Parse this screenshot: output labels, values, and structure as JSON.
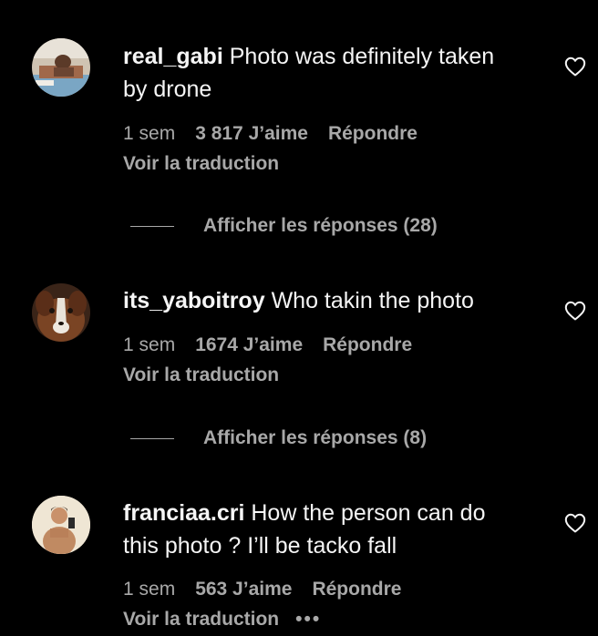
{
  "theme": {
    "background": "#000000",
    "primary_text": "#f5f5f5",
    "secondary_text": "#a8a8a8"
  },
  "comments": [
    {
      "username": "real_gabi",
      "text": "Photo was definitely taken by drone",
      "age": "1 sem",
      "likes": "3 817 J’aime",
      "reply_label": "Répondre",
      "translate_label": "Voir la traduction",
      "replies_label": "Afficher les réponses (28)",
      "like_icon": "heart-outline-icon"
    },
    {
      "username": "its_yaboitroy",
      "text": "Who takin the photo",
      "age": "1 sem",
      "likes": "1674 J’aime",
      "reply_label": "Répondre",
      "translate_label": "Voir la traduction",
      "replies_label": "Afficher les réponses (8)",
      "like_icon": "heart-outline-icon"
    },
    {
      "username": "franciaa.cri",
      "text": "How the person can do this photo ? I’ll be tacko fall",
      "age": "1 sem",
      "likes": "563 J’aime",
      "reply_label": "Répondre",
      "translate_label": "Voir la traduction",
      "more_label": "•••",
      "like_icon": "heart-outline-icon"
    }
  ]
}
